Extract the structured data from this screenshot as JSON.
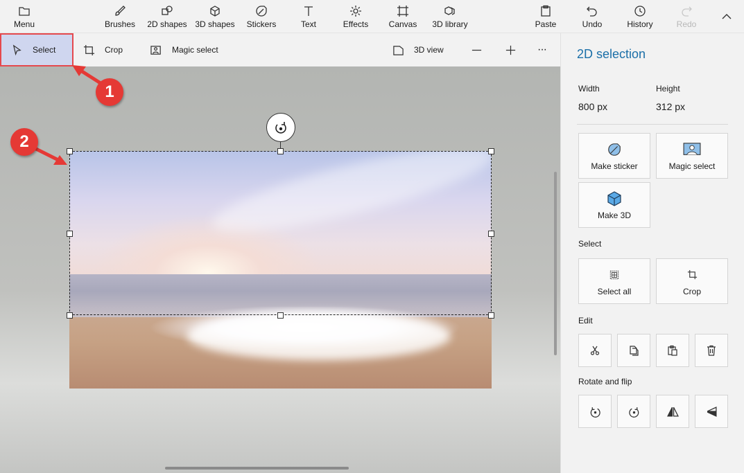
{
  "menu": {
    "menu_label": "Menu",
    "items": [
      {
        "label": "Brushes",
        "icon": "brush-icon"
      },
      {
        "label": "2D shapes",
        "icon": "2d-shapes-icon"
      },
      {
        "label": "3D shapes",
        "icon": "3d-shapes-icon"
      },
      {
        "label": "Stickers",
        "icon": "sticker-icon"
      },
      {
        "label": "Text",
        "icon": "text-icon"
      },
      {
        "label": "Effects",
        "icon": "effects-icon"
      },
      {
        "label": "Canvas",
        "icon": "canvas-icon"
      },
      {
        "label": "3D library",
        "icon": "3d-library-icon"
      }
    ],
    "right": [
      {
        "label": "Paste",
        "icon": "paste-icon"
      },
      {
        "label": "Undo",
        "icon": "undo-icon"
      },
      {
        "label": "History",
        "icon": "history-icon"
      },
      {
        "label": "Redo",
        "icon": "redo-icon",
        "disabled": true
      }
    ]
  },
  "toolbar": {
    "select_label": "Select",
    "crop_label": "Crop",
    "magic_select_label": "Magic select",
    "view_3d_label": "3D view",
    "more_label": "···"
  },
  "callouts": {
    "one": "1",
    "two": "2"
  },
  "panel": {
    "title": "2D selection",
    "width_label": "Width",
    "width_value": "800 px",
    "height_label": "Height",
    "height_value": "312 px",
    "make_sticker": "Make sticker",
    "magic_select": "Magic select",
    "make_3d": "Make 3D",
    "select_section": "Select",
    "select_all": "Select all",
    "crop": "Crop",
    "edit_section": "Edit",
    "rotate_section": "Rotate and flip"
  },
  "colors": {
    "accent": "#1b6fa8",
    "select_highlight": "#cfd6ef",
    "callout_red": "#e53935"
  }
}
